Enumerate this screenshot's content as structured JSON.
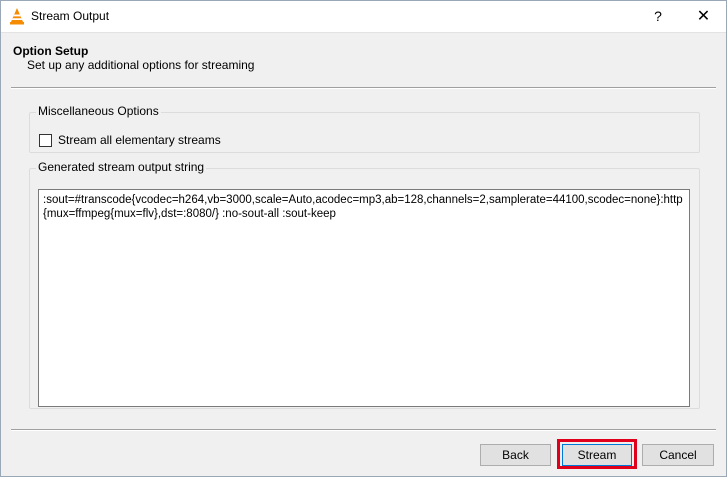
{
  "window": {
    "title": "Stream Output",
    "help_glyph": "?",
    "close_glyph": "✕"
  },
  "header": {
    "title": "Option Setup",
    "subtitle": "Set up any additional options for streaming"
  },
  "misc_options": {
    "legend": "Miscellaneous Options",
    "stream_all_label": "Stream all elementary streams",
    "stream_all_checked": false
  },
  "output_string": {
    "legend": "Generated stream output string",
    "value": ":sout=#transcode{vcodec=h264,vb=3000,scale=Auto,acodec=mp3,ab=128,channels=2,samplerate=44100,scodec=none}:http{mux=ffmpeg{mux=flv},dst=:8080/} :no-sout-all :sout-keep"
  },
  "buttons": {
    "back": "Back",
    "stream": "Stream",
    "cancel": "Cancel"
  },
  "icons": {
    "app": "vlc-cone-icon",
    "help": "help-icon",
    "close": "close-icon"
  },
  "colors": {
    "highlight": "#e0001c",
    "vlc_orange": "#f48b00"
  }
}
